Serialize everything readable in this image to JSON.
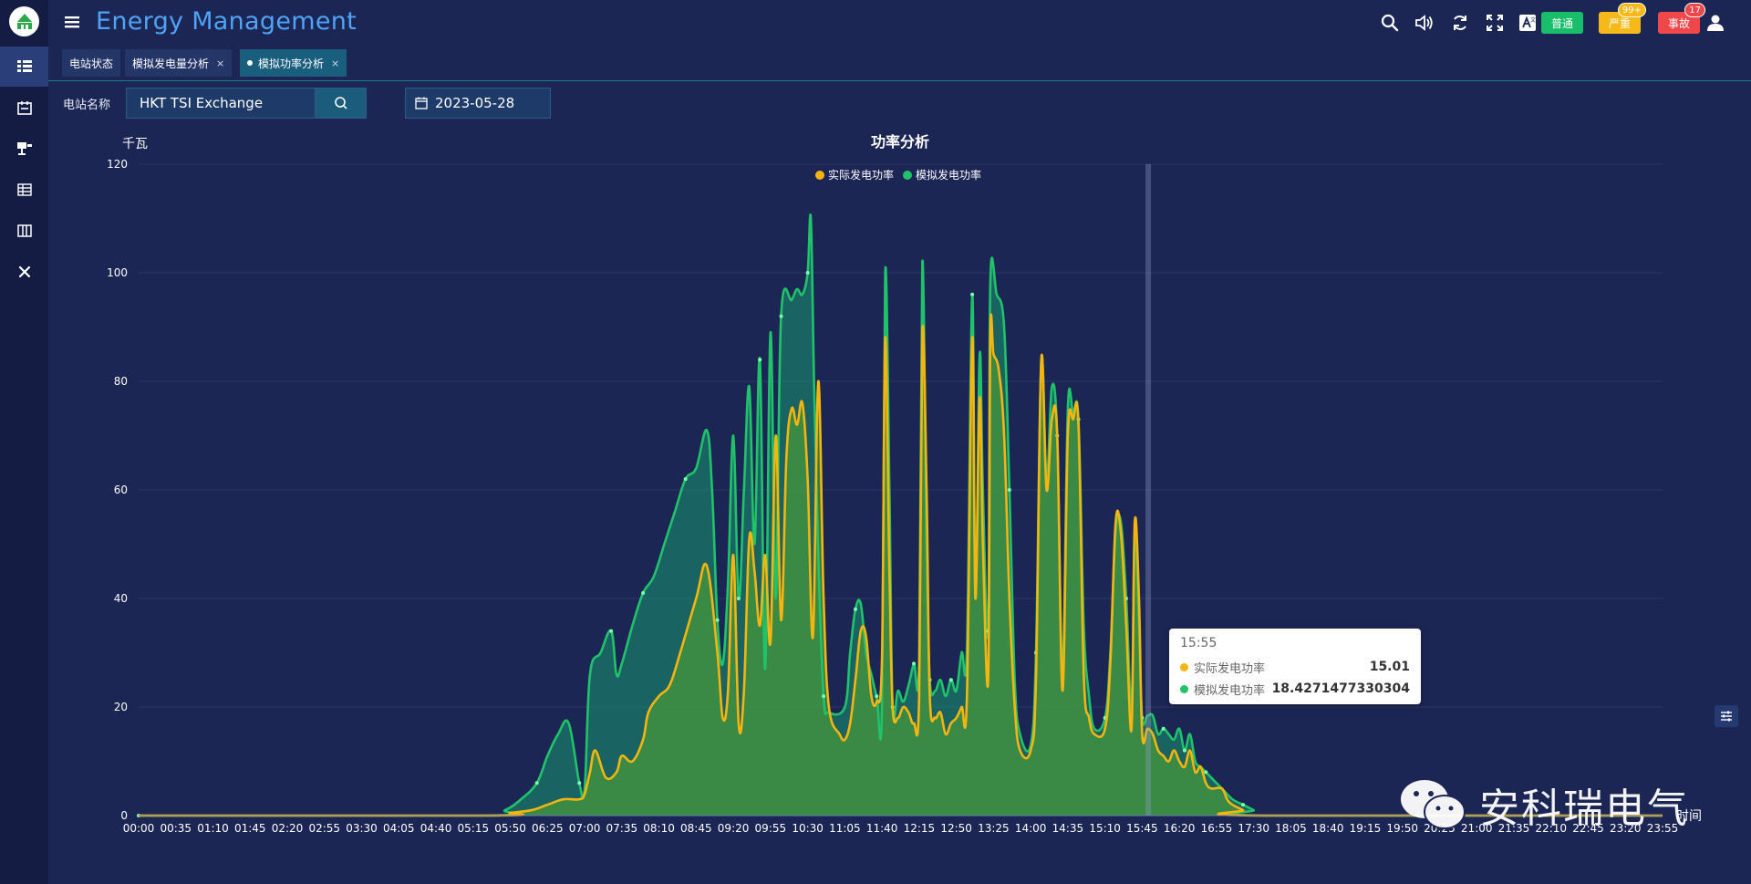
{
  "app": {
    "title": "Energy Management",
    "alarms": [
      {
        "label": "普通",
        "color": "#19be6b",
        "count": ""
      },
      {
        "label": "严重",
        "color": "#f6b91a",
        "count": "99+"
      },
      {
        "label": "事故",
        "color": "#f0484a",
        "count": "17"
      }
    ],
    "toolbar_icons": [
      "search-icon",
      "volume-icon",
      "refresh-icon",
      "fullscreen-icon",
      "translate-icon",
      "user-icon"
    ]
  },
  "sidebar": {
    "items": [
      "grid-icon",
      "building-icon",
      "monitor-icon",
      "table-icon",
      "film-icon",
      "tools-icon"
    ]
  },
  "tabs": [
    {
      "label": "电站状态",
      "closable": false,
      "active": false
    },
    {
      "label": "模拟发电量分析",
      "closable": true,
      "active": false
    },
    {
      "label": "模拟功率分析",
      "closable": true,
      "active": true
    }
  ],
  "filter": {
    "station_label": "电站名称",
    "station_value": "HKT TSI Exchange",
    "date_value": "2023-05-28"
  },
  "tooltip": {
    "time": "15:55",
    "rows": [
      {
        "name": "实际发电功率",
        "value": "15.01",
        "color": "#f5b50e"
      },
      {
        "name": "模拟发电功率",
        "value": "18.4271477330304",
        "color": "#20c26a"
      }
    ]
  },
  "watermark": {
    "text": "安科瑞电气"
  },
  "chart_data": {
    "type": "area",
    "title": "功率分析",
    "ylabel": "千瓦",
    "xlabel": "时间",
    "ylim": [
      0,
      120
    ],
    "yticks": [
      0,
      20,
      40,
      60,
      80,
      100,
      120
    ],
    "grid": true,
    "legend": "top-center",
    "x_tick_labels": [
      "00:00",
      "00:35",
      "01:10",
      "01:45",
      "02:20",
      "02:55",
      "03:30",
      "04:05",
      "04:40",
      "05:15",
      "05:50",
      "06:25",
      "07:00",
      "07:35",
      "08:10",
      "08:45",
      "09:20",
      "09:55",
      "10:30",
      "11:05",
      "11:40",
      "12:15",
      "12:50",
      "13:25",
      "14:00",
      "14:35",
      "15:10",
      "15:45",
      "16:20",
      "16:55",
      "17:30",
      "18:05",
      "18:40",
      "19:15",
      "19:50",
      "20:25",
      "21:00",
      "21:35",
      "22:10",
      "22:45",
      "23:20",
      "23:55"
    ],
    "series": [
      {
        "name": "实际发电功率",
        "color": "#f5b50e",
        "points": [
          [
            "00:00",
            0
          ],
          [
            "05:30",
            0
          ],
          [
            "05:50",
            0.5
          ],
          [
            "06:10",
            1
          ],
          [
            "06:25",
            2
          ],
          [
            "06:40",
            3
          ],
          [
            "06:55",
            3
          ],
          [
            "07:00",
            4
          ],
          [
            "07:05",
            8
          ],
          [
            "07:10",
            12
          ],
          [
            "07:20",
            7
          ],
          [
            "07:30",
            8
          ],
          [
            "07:35",
            11
          ],
          [
            "07:45",
            10
          ],
          [
            "07:55",
            14
          ],
          [
            "08:00",
            19
          ],
          [
            "08:10",
            22
          ],
          [
            "08:20",
            24
          ],
          [
            "08:30",
            30
          ],
          [
            "08:45",
            40
          ],
          [
            "08:55",
            46
          ],
          [
            "09:05",
            30
          ],
          [
            "09:10",
            18
          ],
          [
            "09:15",
            23
          ],
          [
            "09:20",
            48
          ],
          [
            "09:25",
            17
          ],
          [
            "09:30",
            23
          ],
          [
            "09:35",
            51
          ],
          [
            "09:40",
            45
          ],
          [
            "09:45",
            35
          ],
          [
            "09:50",
            48
          ],
          [
            "09:55",
            32
          ],
          [
            "10:00",
            70
          ],
          [
            "10:05",
            36
          ],
          [
            "10:10",
            66
          ],
          [
            "10:15",
            75
          ],
          [
            "10:20",
            72
          ],
          [
            "10:25",
            76
          ],
          [
            "10:30",
            62
          ],
          [
            "10:35",
            33
          ],
          [
            "10:40",
            80
          ],
          [
            "10:45",
            40
          ],
          [
            "10:50",
            20
          ],
          [
            "11:00",
            15
          ],
          [
            "11:05",
            14
          ],
          [
            "11:10",
            17
          ],
          [
            "11:15",
            25
          ],
          [
            "11:20",
            34
          ],
          [
            "11:25",
            33
          ],
          [
            "11:30",
            22
          ],
          [
            "11:35",
            21
          ],
          [
            "11:40",
            29
          ],
          [
            "11:43",
            88
          ],
          [
            "11:47",
            45
          ],
          [
            "11:50",
            20
          ],
          [
            "11:55",
            18
          ],
          [
            "12:00",
            20
          ],
          [
            "12:05",
            19
          ],
          [
            "12:10",
            17
          ],
          [
            "12:15",
            22
          ],
          [
            "12:18",
            89
          ],
          [
            "12:22",
            60
          ],
          [
            "12:25",
            22
          ],
          [
            "12:30",
            18
          ],
          [
            "12:35",
            19
          ],
          [
            "12:40",
            15
          ],
          [
            "12:45",
            17
          ],
          [
            "12:50",
            18
          ],
          [
            "12:55",
            20
          ],
          [
            "13:00",
            22
          ],
          [
            "13:05",
            88
          ],
          [
            "13:08",
            40
          ],
          [
            "13:12",
            77
          ],
          [
            "13:15",
            50
          ],
          [
            "13:20",
            25
          ],
          [
            "13:22",
            88
          ],
          [
            "13:25",
            85
          ],
          [
            "13:30",
            82
          ],
          [
            "13:35",
            70
          ],
          [
            "13:40",
            40
          ],
          [
            "13:45",
            20
          ],
          [
            "13:50",
            12
          ],
          [
            "14:00",
            12
          ],
          [
            "14:05",
            25
          ],
          [
            "14:10",
            84
          ],
          [
            "14:15",
            60
          ],
          [
            "14:20",
            73
          ],
          [
            "14:25",
            70
          ],
          [
            "14:30",
            23
          ],
          [
            "14:35",
            70
          ],
          [
            "14:40",
            73
          ],
          [
            "14:45",
            72
          ],
          [
            "14:50",
            26
          ],
          [
            "14:55",
            18
          ],
          [
            "15:00",
            15
          ],
          [
            "15:10",
            16
          ],
          [
            "15:15",
            28
          ],
          [
            "15:20",
            54
          ],
          [
            "15:25",
            52
          ],
          [
            "15:30",
            35
          ],
          [
            "15:35",
            16
          ],
          [
            "15:38",
            54
          ],
          [
            "15:42",
            40
          ],
          [
            "15:45",
            15
          ],
          [
            "15:50",
            16
          ],
          [
            "15:55",
            15
          ],
          [
            "16:00",
            12
          ],
          [
            "16:05",
            11
          ],
          [
            "16:10",
            10
          ],
          [
            "16:15",
            12
          ],
          [
            "16:20",
            10
          ],
          [
            "16:25",
            9
          ],
          [
            "16:30",
            12
          ],
          [
            "16:35",
            8
          ],
          [
            "16:40",
            9
          ],
          [
            "16:45",
            6
          ],
          [
            "16:50",
            5
          ],
          [
            "17:00",
            5
          ],
          [
            "17:05",
            3
          ],
          [
            "17:10",
            2
          ],
          [
            "17:20",
            1
          ],
          [
            "17:30",
            0
          ],
          [
            "23:55",
            0
          ]
        ]
      },
      {
        "name": "模拟发电功率",
        "color": "#20c26a",
        "points": [
          [
            "00:00",
            0
          ],
          [
            "05:25",
            0
          ],
          [
            "05:45",
            1
          ],
          [
            "06:00",
            3
          ],
          [
            "06:15",
            6
          ],
          [
            "06:25",
            11
          ],
          [
            "06:35",
            15
          ],
          [
            "06:45",
            17
          ],
          [
            "06:55",
            6
          ],
          [
            "07:00",
            5
          ],
          [
            "07:05",
            26
          ],
          [
            "07:15",
            30
          ],
          [
            "07:25",
            34
          ],
          [
            "07:30",
            26
          ],
          [
            "07:35",
            28
          ],
          [
            "07:45",
            35
          ],
          [
            "07:55",
            41
          ],
          [
            "08:05",
            44
          ],
          [
            "08:15",
            50
          ],
          [
            "08:25",
            56
          ],
          [
            "08:35",
            62
          ],
          [
            "08:45",
            64
          ],
          [
            "08:55",
            71
          ],
          [
            "09:00",
            60
          ],
          [
            "09:05",
            36
          ],
          [
            "09:10",
            28
          ],
          [
            "09:15",
            43
          ],
          [
            "09:20",
            70
          ],
          [
            "09:25",
            40
          ],
          [
            "09:30",
            60
          ],
          [
            "09:35",
            79
          ],
          [
            "09:40",
            50
          ],
          [
            "09:45",
            84
          ],
          [
            "09:50",
            27
          ],
          [
            "09:55",
            89
          ],
          [
            "10:00",
            40
          ],
          [
            "10:05",
            92
          ],
          [
            "10:15",
            95
          ],
          [
            "10:20",
            97
          ],
          [
            "10:25",
            96
          ],
          [
            "10:30",
            100
          ],
          [
            "10:33",
            110
          ],
          [
            "10:36",
            80
          ],
          [
            "10:40",
            48
          ],
          [
            "10:45",
            22
          ],
          [
            "10:50",
            19
          ],
          [
            "11:05",
            20
          ],
          [
            "11:10",
            30
          ],
          [
            "11:15",
            38
          ],
          [
            "11:20",
            39
          ],
          [
            "11:25",
            30
          ],
          [
            "11:30",
            26
          ],
          [
            "11:35",
            22
          ],
          [
            "11:40",
            20
          ],
          [
            "11:43",
            100
          ],
          [
            "11:47",
            60
          ],
          [
            "11:50",
            20
          ],
          [
            "11:55",
            23
          ],
          [
            "12:00",
            21
          ],
          [
            "12:05",
            24
          ],
          [
            "12:10",
            28
          ],
          [
            "12:15",
            29
          ],
          [
            "12:18",
            102
          ],
          [
            "12:22",
            50
          ],
          [
            "12:25",
            25
          ],
          [
            "12:30",
            23
          ],
          [
            "12:35",
            25
          ],
          [
            "12:40",
            22
          ],
          [
            "12:45",
            25
          ],
          [
            "12:50",
            23
          ],
          [
            "12:55",
            30
          ],
          [
            "13:00",
            31
          ],
          [
            "13:05",
            96
          ],
          [
            "13:08",
            40
          ],
          [
            "13:12",
            85
          ],
          [
            "13:15",
            60
          ],
          [
            "13:20",
            34
          ],
          [
            "13:22",
            98
          ],
          [
            "13:28",
            96
          ],
          [
            "13:35",
            90
          ],
          [
            "13:40",
            60
          ],
          [
            "13:45",
            25
          ],
          [
            "13:50",
            15
          ],
          [
            "14:00",
            13
          ],
          [
            "14:05",
            30
          ],
          [
            "14:10",
            84
          ],
          [
            "14:15",
            62
          ],
          [
            "14:20",
            79
          ],
          [
            "14:25",
            70
          ],
          [
            "14:30",
            26
          ],
          [
            "14:35",
            75
          ],
          [
            "14:40",
            74
          ],
          [
            "14:45",
            73
          ],
          [
            "14:50",
            35
          ],
          [
            "14:55",
            22
          ],
          [
            "15:00",
            16
          ],
          [
            "15:10",
            18
          ],
          [
            "15:15",
            30
          ],
          [
            "15:20",
            52
          ],
          [
            "15:25",
            54
          ],
          [
            "15:30",
            40
          ],
          [
            "15:35",
            20
          ],
          [
            "15:38",
            52
          ],
          [
            "15:42",
            35
          ],
          [
            "15:45",
            18
          ],
          [
            "15:50",
            18.4
          ],
          [
            "15:55",
            18.43
          ],
          [
            "16:00",
            15
          ],
          [
            "16:05",
            16
          ],
          [
            "16:10",
            15
          ],
          [
            "16:15",
            14
          ],
          [
            "16:20",
            16
          ],
          [
            "16:25",
            12
          ],
          [
            "16:30",
            15
          ],
          [
            "16:35",
            10
          ],
          [
            "16:40",
            9
          ],
          [
            "16:45",
            8
          ],
          [
            "16:50",
            7
          ],
          [
            "17:00",
            5
          ],
          [
            "17:10",
            3
          ],
          [
            "17:20",
            2
          ],
          [
            "17:30",
            1
          ],
          [
            "17:40",
            0
          ],
          [
            "23:55",
            0
          ]
        ]
      }
    ]
  }
}
